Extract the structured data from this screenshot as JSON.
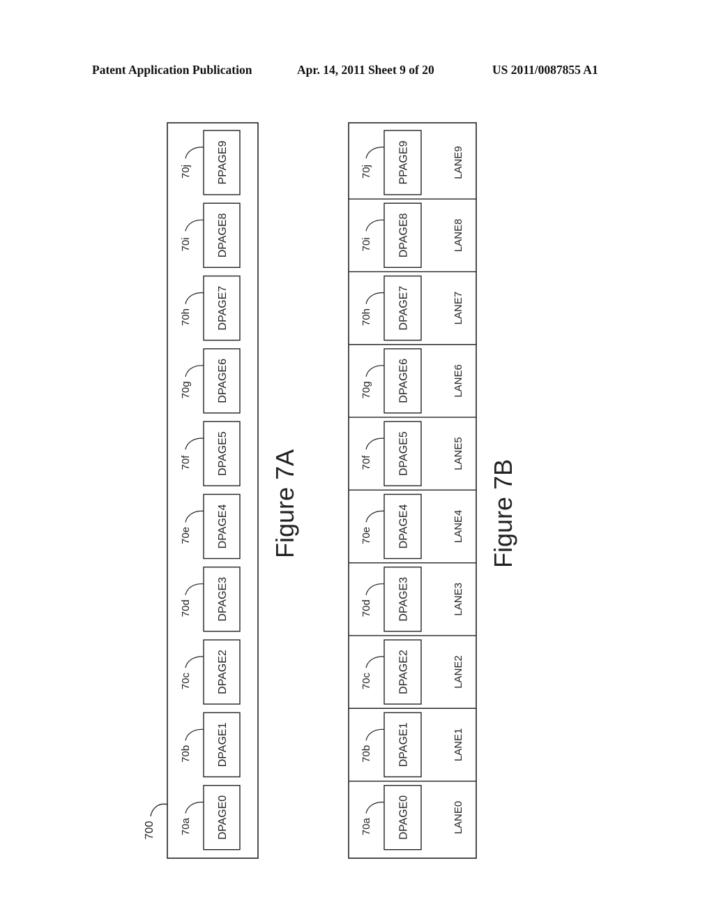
{
  "header": {
    "left": "Patent Application Publication",
    "middle": "Apr. 14, 2011  Sheet 9 of 20",
    "right": "US 2011/0087855 A1"
  },
  "figure_7a": {
    "caption": "Figure 7A",
    "container_ref": "700",
    "pages": [
      {
        "ref": "70a",
        "label": "DPAGE0"
      },
      {
        "ref": "70b",
        "label": "DPAGE1"
      },
      {
        "ref": "70c",
        "label": "DPAGE2"
      },
      {
        "ref": "70d",
        "label": "DPAGE3"
      },
      {
        "ref": "70e",
        "label": "DPAGE4"
      },
      {
        "ref": "70f",
        "label": "DPAGE5"
      },
      {
        "ref": "70g",
        "label": "DPAGE6"
      },
      {
        "ref": "70h",
        "label": "DPAGE7"
      },
      {
        "ref": "70i",
        "label": "DPAGE8"
      },
      {
        "ref": "70j",
        "label": "PPAGE9"
      }
    ]
  },
  "figure_7b": {
    "caption": "Figure 7B",
    "lanes": [
      {
        "ref": "70a",
        "page": "DPAGE0",
        "lane": "LANE0"
      },
      {
        "ref": "70b",
        "page": "DPAGE1",
        "lane": "LANE1"
      },
      {
        "ref": "70c",
        "page": "DPAGE2",
        "lane": "LANE2"
      },
      {
        "ref": "70d",
        "page": "DPAGE3",
        "lane": "LANE3"
      },
      {
        "ref": "70e",
        "page": "DPAGE4",
        "lane": "LANE4"
      },
      {
        "ref": "70f",
        "page": "DPAGE5",
        "lane": "LANE5"
      },
      {
        "ref": "70g",
        "page": "DPAGE6",
        "lane": "LANE6"
      },
      {
        "ref": "70h",
        "page": "DPAGE7",
        "lane": "LANE7"
      },
      {
        "ref": "70i",
        "page": "DPAGE8",
        "lane": "LANE8"
      },
      {
        "ref": "70j",
        "page": "PPAGE9",
        "lane": "LANE9"
      }
    ]
  }
}
